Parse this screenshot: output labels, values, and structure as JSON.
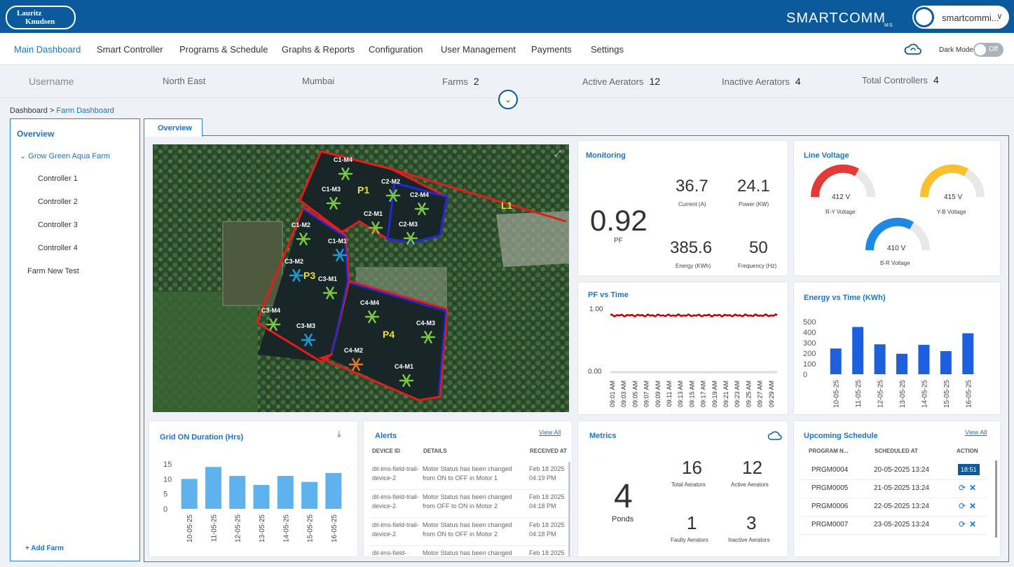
{
  "header": {
    "logo_line1": "Lauritz",
    "logo_line2": "Knudsen",
    "brand": "SMARTCOMM",
    "brand_sub": "MS",
    "user": "smartcommi...",
    "chevron": "∨"
  },
  "nav": {
    "items": [
      "Main Dashboard",
      "Smart Controller",
      "Programs & Schedule",
      "Graphs & Reports",
      "Configuration",
      "User Management",
      "Payments",
      "Settings"
    ],
    "dark_mode_label": "Dark Mode",
    "toggle_state": "Off"
  },
  "info": {
    "username_placeholder": "Username",
    "region": "North East",
    "city": "Mumbai",
    "farms_label": "Farms",
    "farms": "2",
    "active_label": "Active Aerators",
    "active": "12",
    "inactive_label": "Inactive Aerators",
    "inactive": "4",
    "controllers_label": "Total Controllers",
    "controllers": "4"
  },
  "breadcrumb": {
    "root": "Dashboard",
    "sep": ">",
    "current": "Farm Dashboard"
  },
  "sidebar": {
    "title": "Overview",
    "farm": "Grow Green Aqua Farm",
    "controllers": [
      "Controller 1",
      "Controller 2",
      "Controller 3",
      "Controller 4"
    ],
    "farm2": "Farm New Test",
    "add": "+ Add Farm"
  },
  "tab": "Overview",
  "map": {
    "ponds": [
      "P1",
      "P3",
      "P4"
    ],
    "line": "L1",
    "aerators": [
      {
        "id": "C1-M4",
        "state": "on"
      },
      {
        "id": "C1-M3",
        "state": "on"
      },
      {
        "id": "C2-M2",
        "state": "on"
      },
      {
        "id": "C2-M4",
        "state": "on"
      },
      {
        "id": "C2-M1",
        "state": "on"
      },
      {
        "id": "C2-M3",
        "state": "on"
      },
      {
        "id": "C1-M2",
        "state": "on"
      },
      {
        "id": "C1-M1",
        "state": "idle"
      },
      {
        "id": "C3-M2",
        "state": "idle"
      },
      {
        "id": "C3-M1",
        "state": "on"
      },
      {
        "id": "C3-M4",
        "state": "on"
      },
      {
        "id": "C3-M3",
        "state": "idle"
      },
      {
        "id": "C4-M4",
        "state": "on"
      },
      {
        "id": "C4-M3",
        "state": "on"
      },
      {
        "id": "C4-M2",
        "state": "fault"
      },
      {
        "id": "C4-M1",
        "state": "on"
      }
    ]
  },
  "monitoring": {
    "title": "Monitoring",
    "pf": "0.92",
    "pf_label": "PF",
    "current": "36.7",
    "current_label": "Current (A)",
    "power": "24.1",
    "power_label": "Power (KW)",
    "energy": "385.6",
    "energy_label": "Energy (KWh)",
    "freq": "50",
    "freq_label": "Frequency (Hz)"
  },
  "voltage": {
    "title": "Line Voltage",
    "ry": "412 V",
    "ry_label": "R-Y Voltage",
    "yb": "415 V",
    "yb_label": "Y-B Voltage",
    "br": "410 V",
    "br_label": "B-R Voltage"
  },
  "pf_chart": {
    "title": "PF vs Time",
    "ymax_label": "1.00",
    "ymin_label": "0.00",
    "times": [
      "09:01 AM",
      "09:03 AM",
      "09:05 AM",
      "09:07 AM",
      "09:09 AM",
      "09:11 AM",
      "09:13 AM",
      "09:15 AM",
      "09:17 AM",
      "09:19 AM",
      "09:21 AM",
      "09:23 AM",
      "09:25 AM",
      "09:27 AM",
      "09:29 AM"
    ]
  },
  "energy_chart": {
    "title": "Energy vs Time (KWh)",
    "categories": [
      "10-05-25",
      "11-05-25",
      "12-05-25",
      "13-05-25",
      "14-05-25",
      "15-05-25",
      "16-05-25"
    ],
    "values": [
      245,
      450,
      285,
      195,
      280,
      220,
      390
    ],
    "yticks": [
      "500",
      "400",
      "300",
      "200",
      "100",
      "0"
    ],
    "ylim": [
      0,
      500
    ]
  },
  "grid_chart": {
    "title": "Grid ON Duration (Hrs)",
    "categories": [
      "10-05-25",
      "11-05-25",
      "12-05-25",
      "13-05-25",
      "14-05-25",
      "15-05-25",
      "16-05-25"
    ],
    "values": [
      10,
      14,
      11,
      8,
      11,
      9,
      12
    ],
    "yticks": [
      "15",
      "10",
      "5",
      "0"
    ],
    "ylim": [
      0,
      15
    ]
  },
  "alerts": {
    "title": "Alerts",
    "view_all": "View All",
    "headers": [
      "DEVICE ID",
      "DETAILS",
      "RECEIVED AT"
    ],
    "rows": [
      {
        "device": "dit-ims-field-trail-device-2",
        "details": "Motor Status has been changed from ON to OFF in Motor 1",
        "date": "Feb 18 2025",
        "time": "04:19 PM"
      },
      {
        "device": "dit-ims-field-trail-device-2",
        "details": "Motor Status has been changed from OFF to ON in Motor 2",
        "date": "Feb 18 2025",
        "time": "04:18 PM"
      },
      {
        "device": "dit-ims-field-trail-device-2",
        "details": "Motor Status has been changed from ON to OFF in Motor 2",
        "date": "Feb 18 2025",
        "time": "04:18 PM"
      },
      {
        "device": "dit-ims-field-",
        "details": "Motor Status has been changed",
        "date": "Feb 18 2025",
        "time": ""
      }
    ]
  },
  "metrics": {
    "title": "Metrics",
    "ponds": "4",
    "ponds_label": "Ponds",
    "total": "16",
    "total_label": "Total Aerators",
    "active": "12",
    "active_label": "Active Aerators",
    "faulty": "1",
    "faulty_label": "Faulty Aerators",
    "inactive": "3",
    "inactive_label": "Inactive Aerators"
  },
  "schedule": {
    "title": "Upcoming Schedule",
    "view_all": "View All",
    "headers": [
      "PROGRAM N...",
      "SCHEDULED AT",
      "ACTION"
    ],
    "rows": [
      {
        "prog": "PRGM0004",
        "at": "20-05-2025 13:24",
        "action": "18:51"
      },
      {
        "prog": "PRGM0005",
        "at": "21-05-2025 13:24",
        "action": ""
      },
      {
        "prog": "PRGM0006",
        "at": "22-05-2025 13:24",
        "action": ""
      },
      {
        "prog": "PRGM0007",
        "at": "23-05-2025 13:24",
        "action": ""
      }
    ]
  },
  "colors": {
    "brand": "#0a5a9c",
    "accent": "#1a73c8",
    "bar_dark": "#1e5fe0",
    "bar_light": "#5eb3ef",
    "on": "#7ac943",
    "idle": "#1f9ad6",
    "fault": "#e07b1f",
    "pf_line": "#c00000",
    "ry": "#e53935",
    "yb": "#fbc02d",
    "br": "#1e88e5"
  }
}
